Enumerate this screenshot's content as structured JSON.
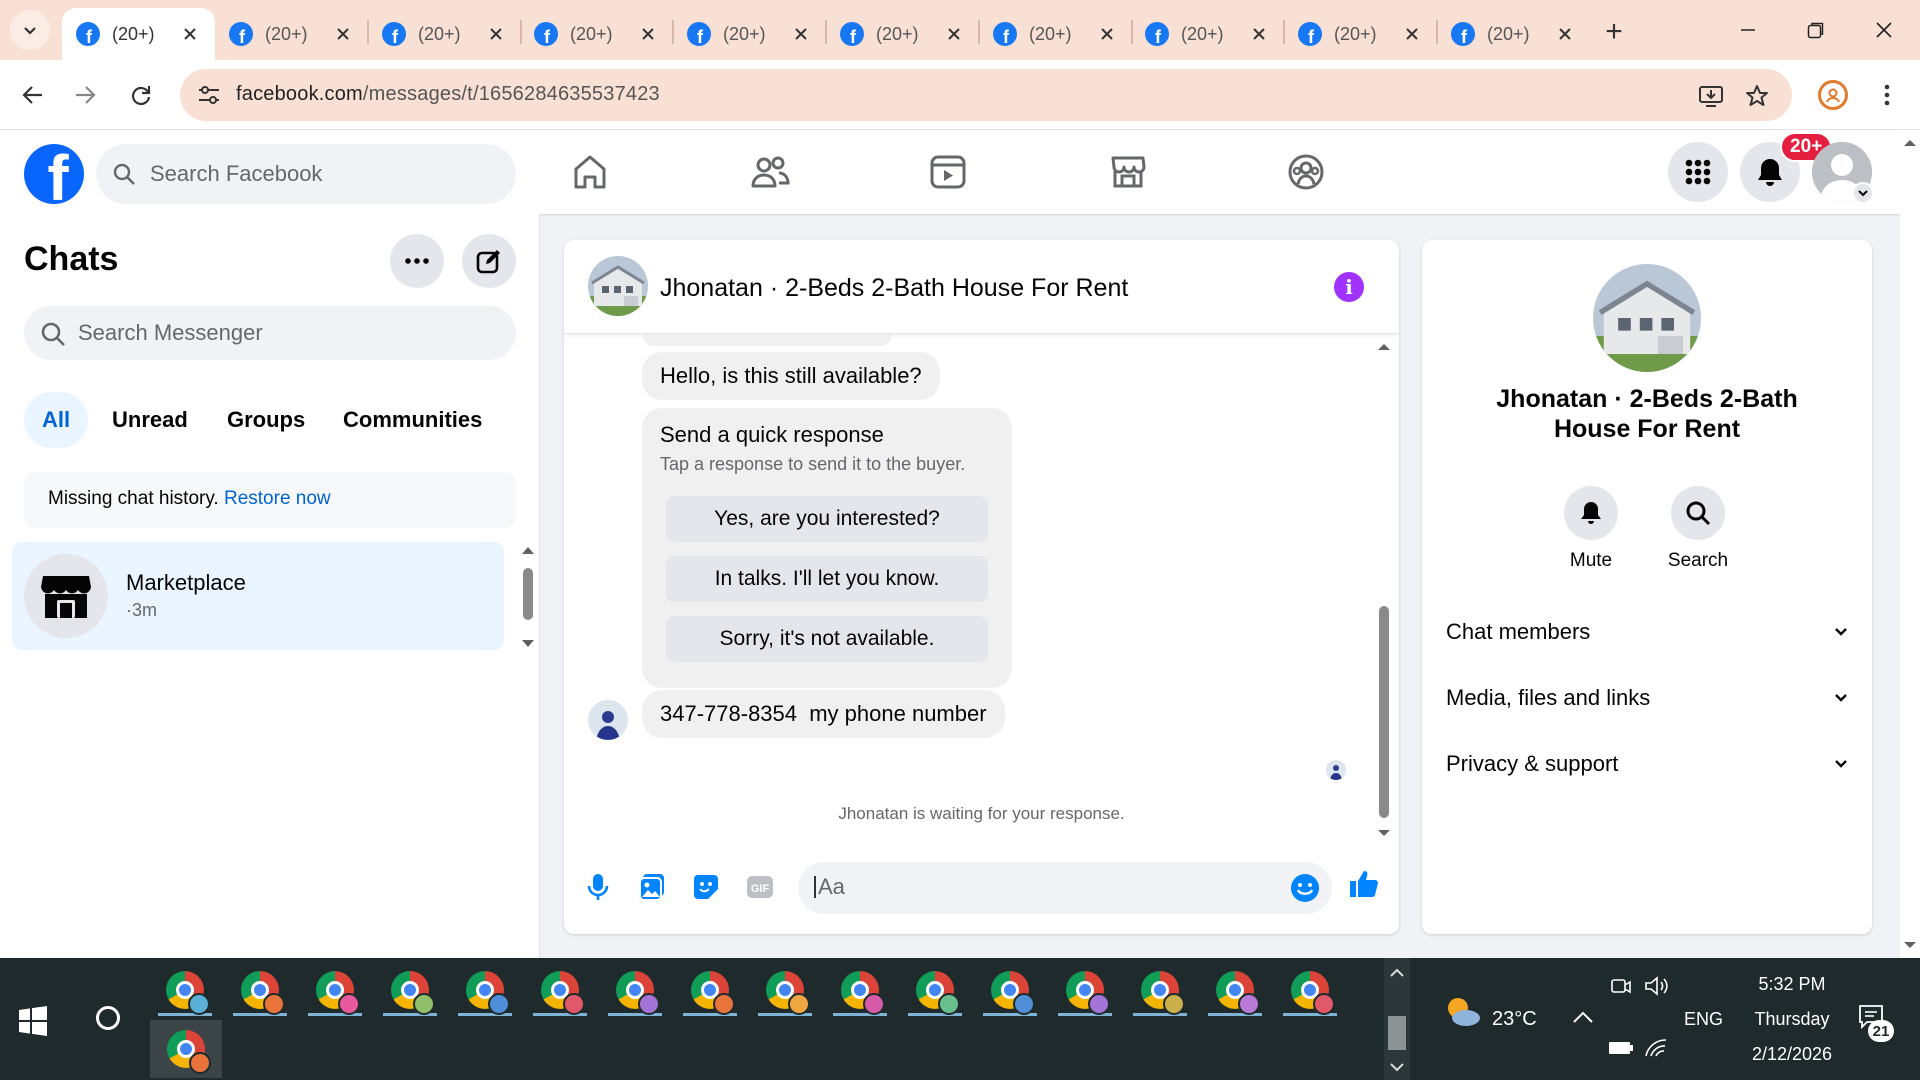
{
  "browser": {
    "tab_count_label": "(20+)",
    "tabs": [
      {
        "title": "(20+)",
        "active": true
      },
      {
        "title": "(20+)",
        "active": false
      },
      {
        "title": "(20+)",
        "active": false
      },
      {
        "title": "(20+)",
        "active": false
      },
      {
        "title": "(20+)",
        "active": false
      },
      {
        "title": "(20+)",
        "active": false
      },
      {
        "title": "(20+)",
        "active": false
      },
      {
        "title": "(20+)",
        "active": false
      },
      {
        "title": "(20+)",
        "active": false
      },
      {
        "title": "(20+)",
        "active": false
      }
    ],
    "favicon_letter": "f",
    "url_host": "facebook.com",
    "url_path": "/messages/t/1656284635537423",
    "icons": [
      "tab-search-icon",
      "new-tab-icon",
      "minimize-icon",
      "restore-icon",
      "close-icon",
      "back-icon",
      "forward-icon",
      "reload-icon",
      "site-info-icon",
      "install-app-icon",
      "bookmark-star-icon",
      "profile-icon",
      "menu-icon"
    ]
  },
  "facebook": {
    "logo_letter": "f",
    "search_placeholder": "Search Facebook",
    "nav_icons": [
      "home-icon",
      "friends-icon",
      "video-icon",
      "marketplace-icon",
      "groups-icon"
    ],
    "notifications_badge": "20+",
    "brand_color": "#0866ff"
  },
  "sidebar": {
    "title": "Chats",
    "search_placeholder": "Search Messenger",
    "filters": [
      "All",
      "Unread",
      "Groups",
      "Communities"
    ],
    "active_filter": "All",
    "missing_text": "Missing chat history.",
    "restore_link": "Restore now",
    "chats": [
      {
        "name": "Marketplace",
        "time": "·3m"
      }
    ]
  },
  "conversation": {
    "title": "Jhonatan · 2-Beds 2-Bath House For Rent",
    "messages": [
      {
        "text": "Hello, is this still available?"
      }
    ],
    "quick_response": {
      "title": "Send a quick response",
      "subtitle": "Tap a response to send it to the buyer.",
      "options": [
        "Yes, are you interested?",
        "In talks. I'll let you know.",
        "Sorry, it's not available."
      ]
    },
    "phone_message": "347-778-8354  my phone number",
    "waiting_text": "Jhonatan is waiting for your response.",
    "composer_placeholder": "Aa",
    "accent_color": "#0084ff"
  },
  "info_panel": {
    "name": "Jhonatan · 2-Beds 2-Bath House For Rent",
    "actions": [
      "Mute",
      "Search"
    ],
    "sections": [
      "Chat members",
      "Media, files and links",
      "Privacy & support"
    ]
  },
  "taskbar": {
    "weather_temp": "23°C",
    "language": "ENG",
    "time": "5:32 PM",
    "day": "Thursday",
    "date": "2/12/2026",
    "notifications_count": "21",
    "pinned_apps": 16,
    "profile_colors": [
      "#5ab0d6",
      "#e8743b",
      "#e85a9b",
      "#8fbf6a",
      "#4f8fd8",
      "#e0586a",
      "#a473d6",
      "#e8743b",
      "#f0a742",
      "#d65aa8",
      "#6abf8f",
      "#4f8fd8",
      "#a473d6",
      "#c9b04a",
      "#b77ad6",
      "#e0586a"
    ]
  }
}
